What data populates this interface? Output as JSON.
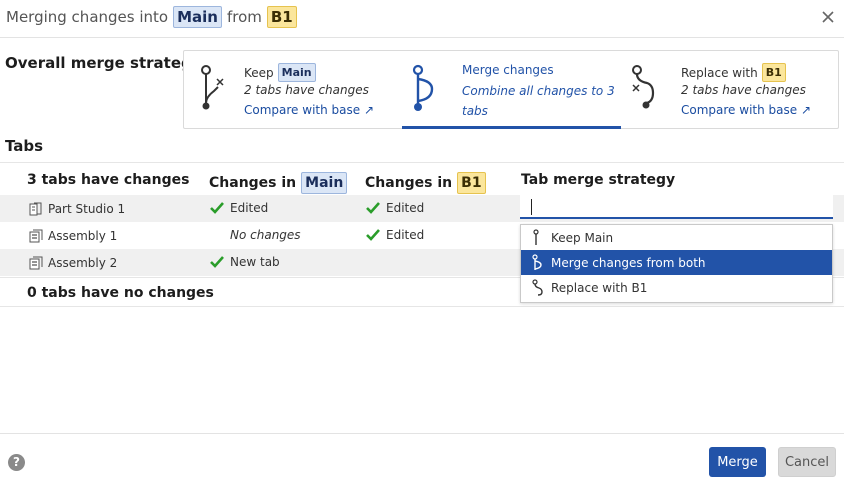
{
  "header": {
    "prefix": "Merging changes into",
    "target_branch": "Main",
    "from_word": "from",
    "source_branch": "B1"
  },
  "strategy": {
    "label": "Overall merge strategy",
    "options": [
      {
        "line1": "Keep",
        "badge": "Main",
        "line2": "2 tabs have changes",
        "link": "Compare with base ↗",
        "icon": "keep-branch-icon",
        "selected": false
      },
      {
        "line1": "Merge changes",
        "line2": "Combine all changes to 3 tabs",
        "icon": "merge-branch-icon",
        "selected": true
      },
      {
        "line1": "Replace with",
        "badge": "B1",
        "line2": "2 tabs have changes",
        "link": "Compare with base ↗",
        "icon": "replace-branch-icon",
        "selected": false
      }
    ]
  },
  "tabs_section": {
    "label": "Tabs",
    "columns": {
      "changed_count": "3 tabs have changes",
      "changes_in": "Changes in",
      "changes_in_main": "Main",
      "changes_in_b1": "B1",
      "tab_strategy": "Tab merge strategy"
    },
    "rows": [
      {
        "name": "Part Studio 1",
        "icon": "part-studio-icon",
        "main": "Edited",
        "main_check": true,
        "b1": "Edited",
        "b1_check": true
      },
      {
        "name": "Assembly 1",
        "icon": "assembly-icon",
        "main": "No changes",
        "main_check": false,
        "b1": "Edited",
        "b1_check": true
      },
      {
        "name": "Assembly 2",
        "icon": "assembly-icon",
        "main": "New tab",
        "main_check": true,
        "b1": "",
        "b1_check": false
      }
    ],
    "no_changes": "0 tabs have no changes"
  },
  "dropdown": {
    "value": "",
    "options": [
      {
        "label": "Keep Main",
        "selected": false
      },
      {
        "label": "Merge changes from both",
        "selected": true
      },
      {
        "label": "Replace with B1",
        "selected": false
      }
    ]
  },
  "footer": {
    "help": "?",
    "merge": "Merge",
    "cancel": "Cancel"
  },
  "colors": {
    "accent": "#2253a8",
    "main_badge": "#dbe6f6",
    "b1_badge": "#fbe69c",
    "check_green": "#2a9d2a"
  }
}
